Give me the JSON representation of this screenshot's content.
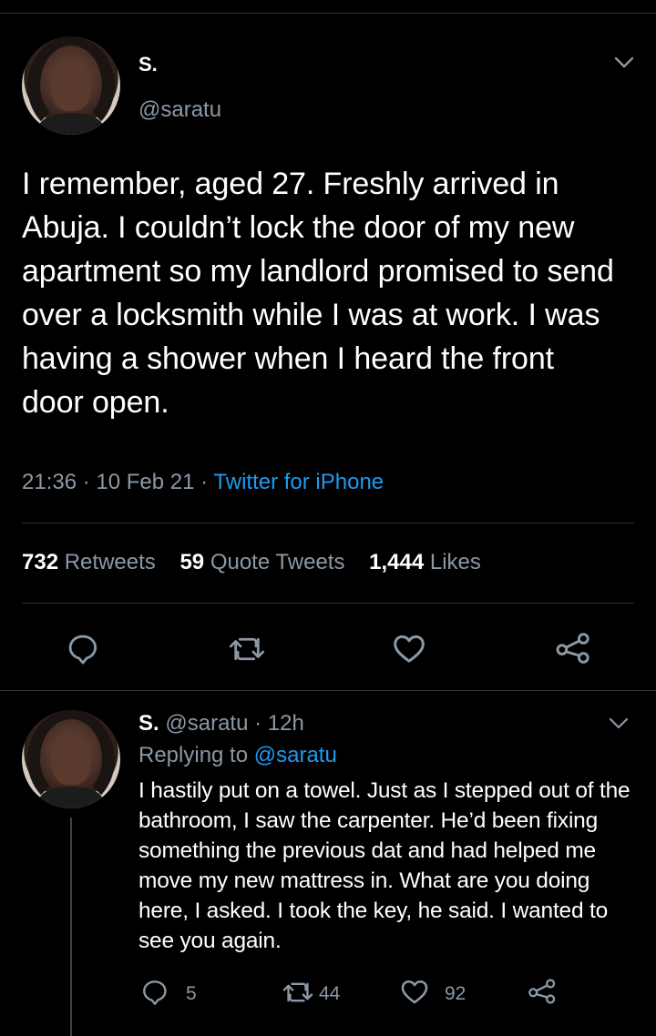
{
  "main_tweet": {
    "display_name": "S.",
    "handle": "@saratu",
    "text": "I remember, aged 27. Freshly arrived in Abuja. I couldn’t lock the door of my new apartment so my landlord promised to send over a locksmith while I was at work. I was having a shower when I heard the front door open.",
    "time": "21:36",
    "date": "10 Feb 21",
    "source": "Twitter for iPhone",
    "retweets_count": "732",
    "retweets_label": "Retweets",
    "quotes_count": "59",
    "quotes_label": "Quote Tweets",
    "likes_count": "1,444",
    "likes_label": "Likes"
  },
  "reply_tweet": {
    "display_name": "S.",
    "handle": "@saratu",
    "age": "12h",
    "replying_label": "Replying to",
    "replying_handle": "@saratu",
    "text": "I hastily put on a towel. Just as I stepped out of the bathroom, I saw the carpenter. He’d been fixing something the previous dat and had helped me move my new mattress in. What are you doing here, I asked. I took the key, he said. I wanted to see you again.",
    "reply_count": "5",
    "retweet_count": "44",
    "like_count": "92"
  },
  "icons": {
    "reply": "reply-icon",
    "retweet": "retweet-icon",
    "like": "heart-icon",
    "share": "share-icon",
    "menu": "chevron-down-icon"
  },
  "colors": {
    "background": "#000000",
    "text": "#ffffff",
    "muted": "#8b98a5",
    "link": "#1d9bf0",
    "divider": "#2f3336"
  }
}
